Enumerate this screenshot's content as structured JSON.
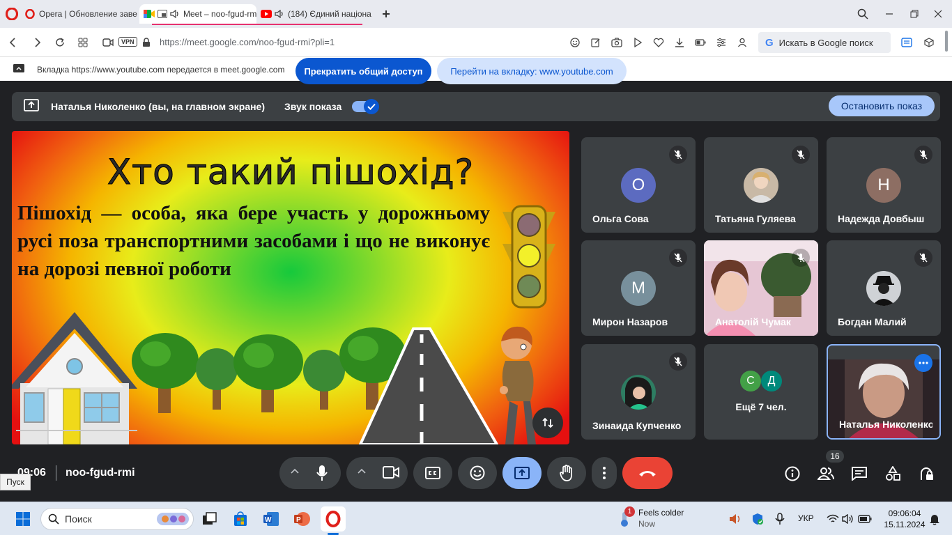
{
  "browser": {
    "tabs": [
      {
        "label": "Opera | Обновление заве"
      },
      {
        "label": "Meet – noo-fgud-rmi"
      },
      {
        "label": "(184) Єдиний націона"
      }
    ],
    "url": "https://meet.google.com/noo-fgud-rmi?pli=1",
    "vpn": "VPN",
    "search_placeholder": "Искать в Google поиск"
  },
  "sharebar": {
    "message": "Вкладка https://www.youtube.com передается в meet.google.com",
    "stop_label": "Прекратить общий доступ",
    "goto_label": "Перейти на вкладку: www.youtube.com"
  },
  "presentation": {
    "presenter": "Наталья Николенко (вы, на главном экране)",
    "sound_label": "Звук показа",
    "stop_label": "Остановить показ"
  },
  "slide": {
    "title": "Хто такий пішохід?",
    "body": "Пішохід — особа, яка бере участь у дорожньому русі поза транспортними засобами і що не виконує на дорозі певної роботи"
  },
  "participants": [
    {
      "name": "Ольга Сова",
      "initial": "О",
      "color": "#5c6bc0",
      "muted": true
    },
    {
      "name": "Татьяна Гуляева",
      "initial": "",
      "color": "#c8b9a6",
      "muted": true
    },
    {
      "name": "Надежда Довбыш",
      "initial": "Н",
      "color": "#8d6e63",
      "muted": true
    },
    {
      "name": "Мирон Назаров",
      "initial": "М",
      "color": "#78909c",
      "muted": true
    },
    {
      "name": "Анатолій Чумак",
      "initial": "",
      "color": "#e6c7d6",
      "muted": true
    },
    {
      "name": "Богдан Малий",
      "initial": "",
      "color": "#cfd2d6",
      "muted": true
    },
    {
      "name": "Зинаида Купченко",
      "initial": "",
      "color": "#2e7d62",
      "muted": true
    },
    {
      "name": "Ещё 7 чел.",
      "initial": "",
      "color": "",
      "muted": false
    },
    {
      "name": "Наталья Николенко",
      "initial": "",
      "color": "#7a5a56",
      "muted": false
    }
  ],
  "more": {
    "a": "С",
    "b": "Д",
    "a_color": "#43a047",
    "b_color": "#00897b"
  },
  "meeting": {
    "time": "09:06",
    "code": "noo-fgud-rmi",
    "participants_count": "16"
  },
  "taskbar": {
    "start_tooltip": "Пуск",
    "search": "Поиск",
    "weather_title": "Feels colder",
    "weather_sub": "Now",
    "weather_badge": "1",
    "lang": "УКР",
    "time": "09:06:04",
    "date": "15.11.2024"
  }
}
